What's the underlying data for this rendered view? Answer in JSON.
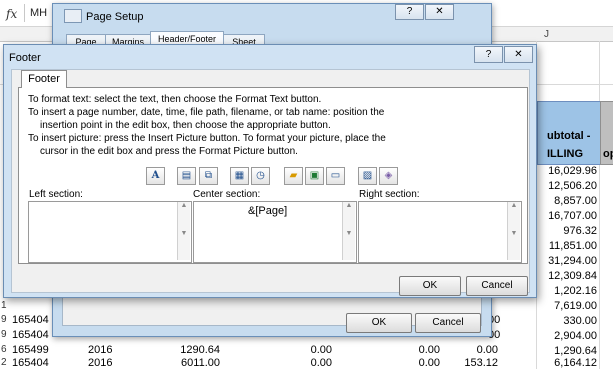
{
  "excel": {
    "fx_label": "fx",
    "fx_content": "MH",
    "column_j": "J",
    "header_subtotal_line1": "ubtotal -",
    "header_subtotal_line2": "ILLING",
    "header_next": "op",
    "subtotal_values": [
      "16,029.96",
      "12,506.20",
      "8,857.00",
      "16,707.00",
      "976.32",
      "11,851.00",
      "31,294.00",
      "12,309.84",
      "1,202.16",
      "7,619.00",
      "330.00",
      "2,904.00",
      "1,290.64",
      "6,164.12"
    ],
    "row_prefixes": [
      "1",
      "9",
      "9",
      "6",
      "2"
    ],
    "row_ids": [
      "165404",
      "165404",
      "165499",
      "165404"
    ],
    "bottom_rows": [
      {
        "a": "165499",
        "b": "2016",
        "c": "1290.64",
        "d": "0.00",
        "e": "0.00",
        "f": "0.00"
      },
      {
        "a": "165404",
        "b": "2016",
        "c": "6011.00",
        "d": "0.00",
        "e": "0.00",
        "f": "153.12"
      }
    ],
    "partial_vals": [
      "00",
      "00"
    ]
  },
  "page_setup": {
    "title": "Page Setup",
    "help_label": "?",
    "close_label": "✕",
    "tabs": [
      "Page",
      "Margins",
      "Header/Footer",
      "Sheet"
    ],
    "ok_label": "OK",
    "cancel_label": "Cancel"
  },
  "footer_dialog": {
    "title": "Footer",
    "help_label": "?",
    "close_label": "✕",
    "tab_label": "Footer",
    "instructions": [
      "To format text:  select the text, then choose the Format Text button.",
      "To insert a page number, date, time, file path, filename, or tab name:  position the",
      "insertion point in the edit box, then choose the appropriate button.",
      "To insert picture: press the Insert Picture button.  To format your picture, place the",
      "cursor in the edit box and press the Format Picture button."
    ],
    "toolbar_icons": [
      "format-text-icon",
      "page-number-icon",
      "number-of-pages-icon",
      "date-icon",
      "time-icon",
      "file-path-icon",
      "filename-icon",
      "sheet-name-icon",
      "insert-picture-icon",
      "format-picture-icon"
    ],
    "format_text_glyph": "A",
    "left_label": "Left section:",
    "center_label": "Center section:",
    "right_label": "Right section:",
    "left_value": "",
    "center_value": "&[Page]",
    "right_value": "",
    "ok_label": "OK",
    "cancel_label": "Cancel"
  }
}
